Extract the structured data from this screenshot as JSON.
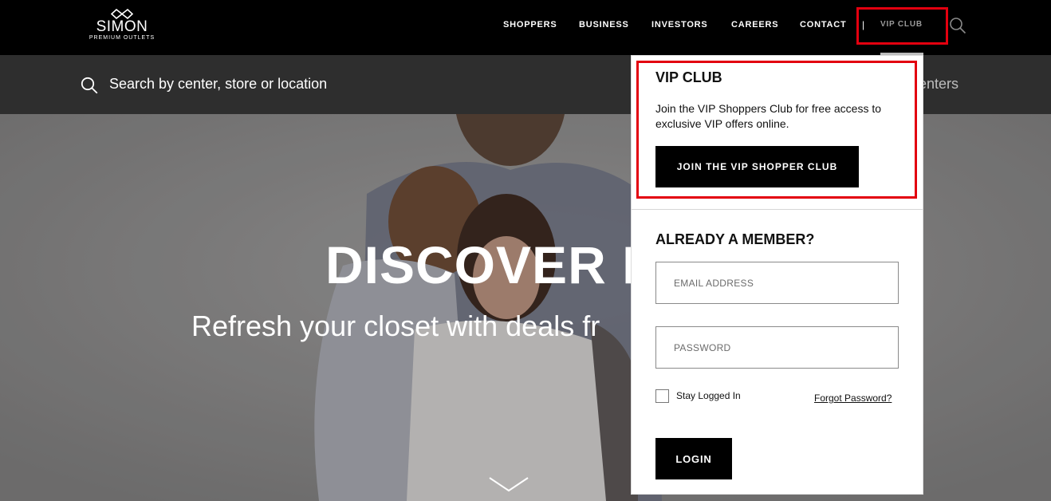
{
  "brand": {
    "name": "SIMON",
    "tagline": "PREMIUM OUTLETS"
  },
  "nav": {
    "items": [
      "SHOPPERS",
      "BUSINESS",
      "INVESTORS",
      "CAREERS",
      "CONTACT"
    ],
    "separator": "|",
    "vip_label": "VIP CLUB"
  },
  "search": {
    "placeholder": "Search by center, store or location",
    "trailing_text": "enters"
  },
  "hero": {
    "title": "DISCOVER F",
    "subtitle": "Refresh your closet with deals fr"
  },
  "vip_dropdown": {
    "title": "VIP CLUB",
    "description": "Join the VIP Shoppers Club for free access to exclusive VIP offers online.",
    "join_button": "JOIN THE VIP SHOPPER CLUB",
    "member_title": "ALREADY A MEMBER?",
    "email_placeholder": "EMAIL ADDRESS",
    "password_placeholder": "PASSWORD",
    "stay_logged_in": "Stay Logged In",
    "forgot_password": "Forgot Password?",
    "login_button": "LOGIN"
  },
  "colors": {
    "highlight": "#e3000f",
    "nav_bg": "#000000"
  }
}
